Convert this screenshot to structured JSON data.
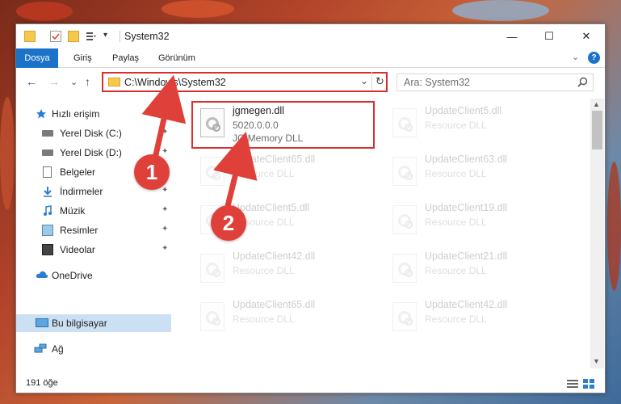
{
  "window": {
    "title": "System32",
    "controls": {
      "minimize": "—",
      "maximize": "☐",
      "close": "✕"
    }
  },
  "ribbon": {
    "file_tab": "Dosya",
    "tabs": [
      "Giriş",
      "Paylaş",
      "Görünüm"
    ],
    "collapse_icon": "⌄",
    "help": "?"
  },
  "nav": {
    "back": "←",
    "forward": "→",
    "recent": "⌄",
    "up": "↑",
    "address": "C:\\Windows\\System32",
    "address_chevron": "⌄",
    "refresh": "↻",
    "search_placeholder": "Ara: System32",
    "search_icon": "⌕"
  },
  "sidebar": {
    "items": [
      {
        "label": "Hızlı erişim",
        "icon": "star-icon"
      },
      {
        "label": "Yerel Disk (C:)",
        "icon": "drive-icon",
        "pinned": true
      },
      {
        "label": "Yerel Disk (D:)",
        "icon": "drive-icon",
        "pinned": true
      },
      {
        "label": "Belgeler",
        "icon": "document-icon",
        "pinned": true
      },
      {
        "label": "İndirmeler",
        "icon": "download-icon",
        "pinned": true
      },
      {
        "label": "Müzik",
        "icon": "music-icon",
        "pinned": true
      },
      {
        "label": "Resimler",
        "icon": "pictures-icon",
        "pinned": true
      },
      {
        "label": "Videolar",
        "icon": "video-icon",
        "pinned": true
      },
      {
        "label": "OneDrive",
        "icon": "cloud-icon"
      },
      {
        "label": "Bu bilgisayar",
        "icon": "computer-icon",
        "selected": true
      },
      {
        "label": "Ağ",
        "icon": "network-icon"
      }
    ],
    "pin_glyph": "📌"
  },
  "files": [
    {
      "name": "jgmegen.dll",
      "version": "5020.0.0.0",
      "desc": "JG Memory DLL",
      "highlighted": true
    },
    {
      "name": "UpdateClient5.dll",
      "desc": "Resource DLL"
    },
    {
      "name": "UpdateClient65.dll",
      "desc": "Resource DLL"
    },
    {
      "name": "UpdateClient63.dll",
      "desc": "Resource DLL"
    },
    {
      "name": "UpdateClient5.dll",
      "desc": "Resource DLL"
    },
    {
      "name": "UpdateClient19.dll",
      "desc": "Resource DLL"
    },
    {
      "name": "UpdateClient42.dll",
      "desc": "Resource DLL"
    },
    {
      "name": "UpdateClient21.dll",
      "desc": "Resource DLL"
    },
    {
      "name": "UpdateClient65.dll",
      "desc": "Resource DLL"
    },
    {
      "name": "UpdateClient42.dll",
      "desc": "Resource DLL"
    }
  ],
  "status": {
    "count": "191 öğe"
  },
  "annotations": {
    "step1": "1",
    "step2": "2",
    "color": "#e0403a"
  },
  "colors": {
    "accent": "#1a73c9",
    "highlight": "#d82f2f",
    "selection": "#cce0f4"
  }
}
